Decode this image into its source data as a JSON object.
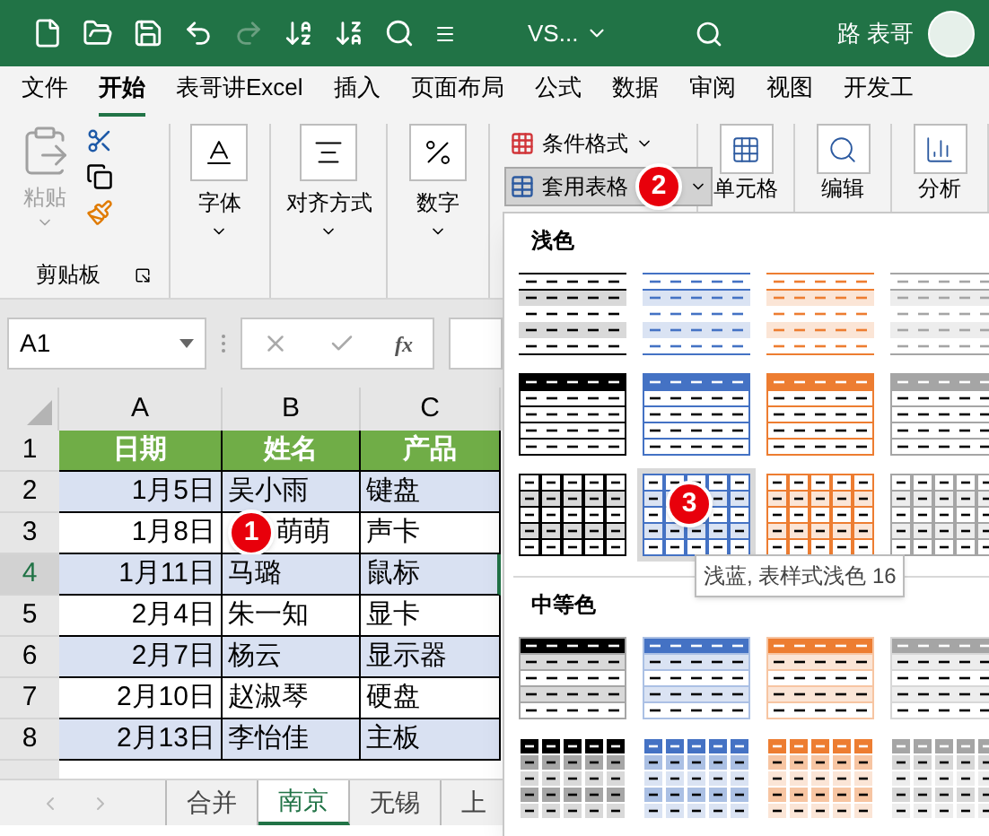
{
  "title_bar": {
    "quick_access": [
      {
        "kind": "new",
        "disabled": false
      },
      {
        "kind": "open",
        "disabled": false
      },
      {
        "kind": "save",
        "disabled": false
      },
      {
        "kind": "undo",
        "disabled": false
      },
      {
        "kind": "redo",
        "disabled": true
      },
      {
        "kind": "sort-asc",
        "disabled": false
      },
      {
        "kind": "sort-desc",
        "disabled": false
      },
      {
        "kind": "find",
        "disabled": false
      },
      {
        "kind": "customize",
        "disabled": false
      }
    ],
    "file_name": "VS...",
    "user": "路 表哥"
  },
  "ribbon_tabs": [
    {
      "label": "文件",
      "selected": false
    },
    {
      "label": "开始",
      "selected": true
    },
    {
      "label": "表哥讲Excel",
      "selected": false
    },
    {
      "label": "插入",
      "selected": false
    },
    {
      "label": "页面布局",
      "selected": false
    },
    {
      "label": "公式",
      "selected": false
    },
    {
      "label": "数据",
      "selected": false
    },
    {
      "label": "审阅",
      "selected": false
    },
    {
      "label": "视图",
      "selected": false
    },
    {
      "label": "开发工",
      "selected": false
    }
  ],
  "ribbon": {
    "clipboard": {
      "paste": {
        "label": "粘贴",
        "disabled": true
      },
      "group_label": "剪贴板"
    },
    "big_buttons": [
      {
        "kind": "font",
        "label": "字体"
      },
      {
        "kind": "alignment",
        "label": "对齐方式"
      },
      {
        "kind": "number",
        "label": "数字"
      }
    ],
    "styles": [
      {
        "kind": "conditional",
        "label": "条件格式",
        "selected": false
      },
      {
        "kind": "table",
        "label": "套用表格",
        "selected": true,
        "callout": "2"
      }
    ],
    "more": [
      {
        "kind": "cells",
        "label": "单元格"
      },
      {
        "kind": "editing",
        "label": "编辑"
      },
      {
        "kind": "analysis",
        "label": "分析"
      }
    ]
  },
  "formula_bar": {
    "name_box": "A1",
    "function_label": "fx"
  },
  "sheet": {
    "columns": [
      "A",
      "B",
      "C"
    ],
    "header_row": {
      "number": "1",
      "cells": [
        "日期",
        "姓名",
        "产品"
      ]
    },
    "rows": [
      {
        "number": "2",
        "cells": [
          "1月5日",
          "吴小雨",
          "键盘"
        ],
        "banded": true,
        "selected": false
      },
      {
        "number": "3",
        "cells": [
          "1月8日",
          "萌萌",
          "声卡"
        ],
        "banded": false,
        "selected": false,
        "callout": "1"
      },
      {
        "number": "4",
        "cells": [
          "1月11日",
          "马璐",
          "鼠标"
        ],
        "banded": true,
        "selected": true
      },
      {
        "number": "5",
        "cells": [
          "2月4日",
          "朱一知",
          "显卡"
        ],
        "banded": false,
        "selected": false
      },
      {
        "number": "6",
        "cells": [
          "2月7日",
          "杨云",
          "显示器"
        ],
        "banded": true,
        "selected": false
      },
      {
        "number": "7",
        "cells": [
          "2月10日",
          "赵淑琴",
          "硬盘"
        ],
        "banded": false,
        "selected": false
      },
      {
        "number": "8",
        "cells": [
          "2月13日",
          "李怡佳",
          "主板"
        ],
        "banded": true,
        "selected": false
      }
    ]
  },
  "sheet_tabs": [
    {
      "label": "合并",
      "selected": false
    },
    {
      "label": "南京",
      "selected": true
    },
    {
      "label": "无锡",
      "selected": false
    },
    {
      "label": "上",
      "selected": false
    }
  ],
  "gallery": {
    "sections": [
      {
        "title": "浅色",
        "rows": [
          [
            {
              "kind": "light-banded",
              "color": "#000000",
              "selected": false
            },
            {
              "kind": "light-banded",
              "color": "#4472c4",
              "selected": false
            },
            {
              "kind": "light-banded",
              "color": "#ed7d31",
              "selected": false
            },
            {
              "kind": "light-banded",
              "color": "#a5a5a5",
              "selected": false
            }
          ],
          [
            {
              "kind": "light-header",
              "color": "#000000",
              "selected": false
            },
            {
              "kind": "light-header",
              "color": "#4472c4",
              "selected": false
            },
            {
              "kind": "light-header",
              "color": "#ed7d31",
              "selected": false
            },
            {
              "kind": "light-header",
              "color": "#a5a5a5",
              "selected": false
            }
          ],
          [
            {
              "kind": "light-grid",
              "color": "#000000",
              "selected": false
            },
            {
              "kind": "light-grid",
              "color": "#4472c4",
              "selected": true,
              "callout": "3"
            },
            {
              "kind": "light-grid",
              "color": "#ed7d31",
              "selected": false
            },
            {
              "kind": "light-grid",
              "color": "#a5a5a5",
              "selected": false
            }
          ]
        ]
      },
      {
        "title": "中等色",
        "rows": [
          [
            {
              "kind": "medium-banded",
              "color": "#000000",
              "selected": false
            },
            {
              "kind": "medium-banded",
              "color": "#4472c4",
              "selected": false
            },
            {
              "kind": "medium-banded",
              "color": "#ed7d31",
              "selected": false
            },
            {
              "kind": "medium-banded",
              "color": "#a5a5a5",
              "selected": false
            }
          ],
          [
            {
              "kind": "medium-grid",
              "color": "#000000",
              "selected": false
            },
            {
              "kind": "medium-grid",
              "color": "#4472c4",
              "selected": false
            },
            {
              "kind": "medium-grid",
              "color": "#ed7d31",
              "selected": false
            },
            {
              "kind": "medium-grid",
              "color": "#a5a5a5",
              "selected": false
            }
          ]
        ]
      }
    ],
    "tooltip": "浅蓝, 表样式浅色 16"
  }
}
